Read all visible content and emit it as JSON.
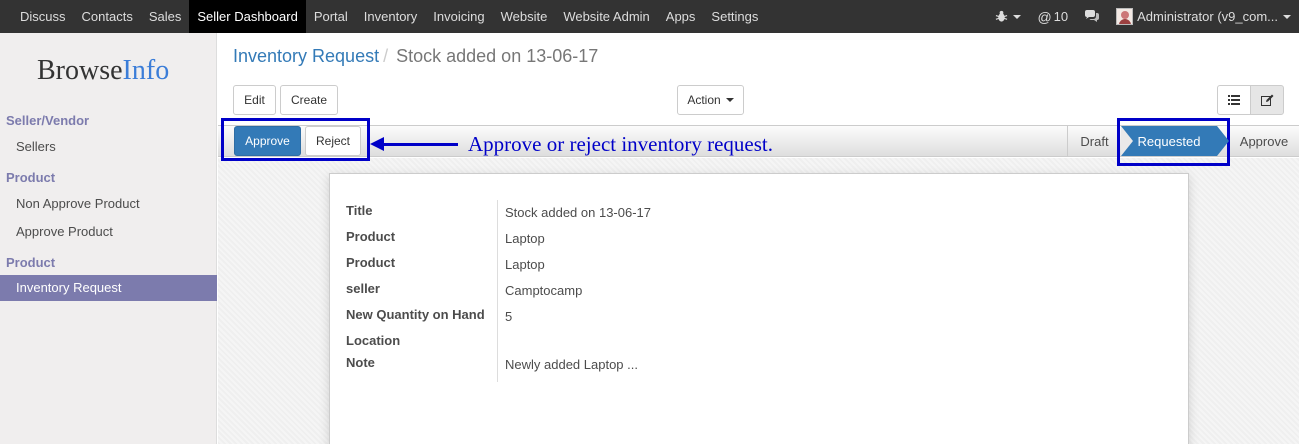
{
  "topnav": {
    "items": [
      "Discuss",
      "Contacts",
      "Sales",
      "Seller Dashboard",
      "Portal",
      "Inventory",
      "Invoicing",
      "Website",
      "Website Admin",
      "Apps",
      "Settings"
    ],
    "active": "Seller Dashboard",
    "messages_count": "10",
    "user": "Administrator (v9_com..."
  },
  "sidebar": {
    "logo_browse": "Browse",
    "logo_info": "Info",
    "section1": "Seller/Vendor",
    "sellers": "Sellers",
    "section2": "Product",
    "non_approve": "Non Approve Product",
    "approve_product": "Approve Product",
    "section3": "Product",
    "inventory_request": "Inventory Request"
  },
  "breadcrumb": {
    "parent": "Inventory Request",
    "separator": "/",
    "current": "Stock added on 13-06-17"
  },
  "toolbar": {
    "edit": "Edit",
    "create": "Create",
    "action": "Action"
  },
  "statusbar": {
    "approve": "Approve",
    "reject": "Reject",
    "stages": [
      "Draft",
      "Requested",
      "Approve"
    ],
    "current_stage": "Requested"
  },
  "annotation": "Approve or reject inventory request.",
  "form": {
    "fields": [
      {
        "label": "Title",
        "value": "Stock added on 13-06-17"
      },
      {
        "label": "Product",
        "value": "Laptop"
      },
      {
        "label": "Product",
        "value": "Laptop"
      },
      {
        "label": "seller",
        "value": "Camptocamp"
      },
      {
        "label": "New Quantity on Hand",
        "value": "5"
      },
      {
        "label": "Location",
        "value": ""
      },
      {
        "label": "Note",
        "value": "Newly added Laptop ..."
      }
    ]
  },
  "colors": {
    "topbar": "#333333",
    "sidebar_accent": "#7c7bad",
    "primary": "#337ab7",
    "annotation": "#0000c8"
  }
}
